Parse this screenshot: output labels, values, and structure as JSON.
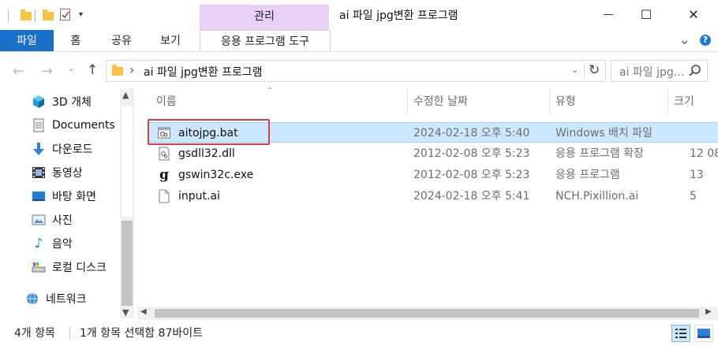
{
  "window": {
    "title": "ai 파일 jpg변환 프로그램",
    "context_tab": "관리",
    "controls": {
      "minimize": "—",
      "maximize": "☐",
      "close": "✕"
    }
  },
  "ribbon": {
    "tabs": [
      "파일",
      "홈",
      "공유",
      "보기",
      "응용 프로그램 도구"
    ],
    "expand_glyph": "⌄"
  },
  "address": {
    "path": "ai 파일 jpg변환 프로그램",
    "separator": "›"
  },
  "search": {
    "placeholder": "ai 파일 jpg..."
  },
  "nav": {
    "items": [
      {
        "label": "3D 개체",
        "icon": "3d-objects-icon"
      },
      {
        "label": "Documents",
        "icon": "documents-icon"
      },
      {
        "label": "다운로드",
        "icon": "downloads-icon"
      },
      {
        "label": "동영상",
        "icon": "videos-icon"
      },
      {
        "label": "바탕 화면",
        "icon": "desktop-icon"
      },
      {
        "label": "사진",
        "icon": "pictures-icon"
      },
      {
        "label": "음악",
        "icon": "music-icon"
      },
      {
        "label": "로컬 디스크",
        "icon": "local-disk-icon"
      }
    ],
    "network": {
      "label": "네트워크",
      "icon": "network-icon"
    }
  },
  "columns": {
    "name": "이름",
    "date": "수정한 날짜",
    "type": "유형",
    "size": "크기"
  },
  "files": [
    {
      "name": "aitojpg.bat",
      "date": "2024-02-18 오후 5:40",
      "type": "Windows 배치 파일",
      "size": "",
      "icon": "batch-file-icon",
      "selected": true
    },
    {
      "name": "gsdll32.dll",
      "date": "2012-02-08 오후 5:23",
      "type": "응용 프로그램 확장",
      "size": "12 08",
      "icon": "dll-file-icon",
      "selected": false
    },
    {
      "name": "gswin32c.exe",
      "date": "2012-02-08 오후 5:23",
      "type": "응용 프로그램",
      "size": "13",
      "icon": "ghostscript-exe-icon",
      "selected": false
    },
    {
      "name": "input.ai",
      "date": "2024-02-18 오후 5:41",
      "type": "NCH.Pixillion.ai",
      "size": "5",
      "icon": "blank-file-icon",
      "selected": false
    }
  ],
  "status": {
    "count": "4개 항목",
    "selection": "1개 항목 선택함 87바이트"
  },
  "colors": {
    "file_tab": "#1a6fc9",
    "context_tab": "#e8d0f6",
    "selection": "#cce8ff",
    "highlight": "#e0393e"
  }
}
